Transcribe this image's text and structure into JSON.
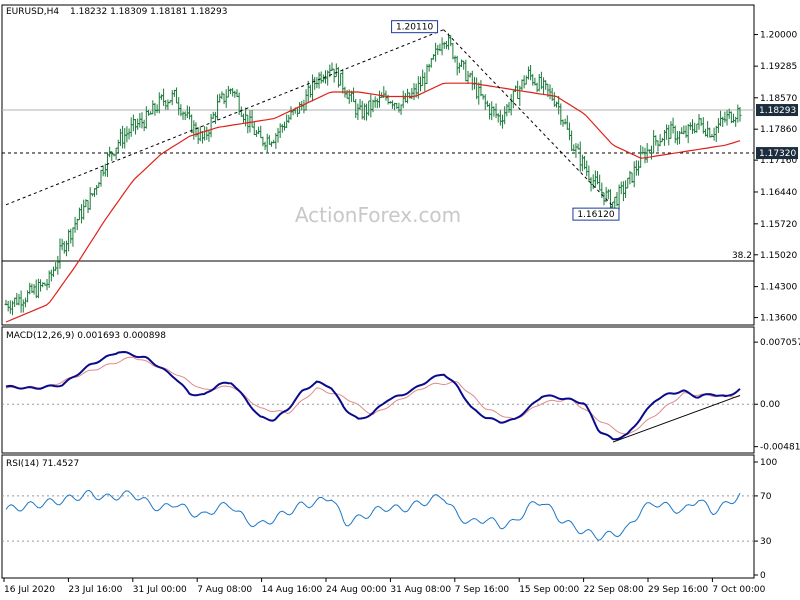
{
  "header": {
    "symbol": "EURUSD,H4",
    "ohlc": "1.18232 1.18309 1.18181 1.18293"
  },
  "watermark": "ActionForex.com",
  "colors": {
    "bars": "#1a7a3a",
    "ma": "#e0201a",
    "macd": "#0a0a8c",
    "signal": "#e08a8a",
    "rsi": "#1e78c8",
    "trendline": "#000000",
    "level": "#000000"
  },
  "chart_data": [
    {
      "type": "ohlc",
      "title": "EURUSD,H4 1.18232 1.18309 1.18181 1.18293",
      "x_ticks": [
        "16 Jul 2020",
        "23 Jul 16:00",
        "31 Jul 00:00",
        "7 Aug 08:00",
        "14 Aug 16:00",
        "24 Aug 00:00",
        "31 Aug 08:00",
        "7 Sep 16:00",
        "15 Sep 00:00",
        "22 Sep 08:00",
        "29 Sep 16:00",
        "7 Oct 00:00"
      ],
      "y_ticks": [
        "1.20000",
        "1.19285",
        "1.18570",
        "1.17860",
        "1.17160",
        "1.16440",
        "1.15720",
        "1.15020",
        "1.14300",
        "1.13600"
      ],
      "ylim": [
        1.135,
        1.206
      ],
      "current_price": "1.18293",
      "horizontal_level": "1.17320",
      "fib_level_label": "38.2",
      "fib_level_value": 1.1488,
      "annotations": [
        {
          "label": "1.20110",
          "value": 1.2011
        },
        {
          "label": "1.16120",
          "value": 1.1612
        }
      ],
      "series_close_anchors": [
        [
          0,
          1.139
        ],
        [
          3,
          1.141
        ],
        [
          6,
          1.144
        ],
        [
          8,
          1.152
        ],
        [
          10,
          1.158
        ],
        [
          12,
          1.163
        ],
        [
          14,
          1.171
        ],
        [
          16,
          1.176
        ],
        [
          18,
          1.179
        ],
        [
          20,
          1.181
        ],
        [
          22,
          1.185
        ],
        [
          24,
          1.186
        ],
        [
          26,
          1.18
        ],
        [
          28,
          1.176
        ],
        [
          30,
          1.184
        ],
        [
          32,
          1.188
        ],
        [
          34,
          1.181
        ],
        [
          36,
          1.176
        ],
        [
          38,
          1.177
        ],
        [
          40,
          1.181
        ],
        [
          42,
          1.184
        ],
        [
          44,
          1.19
        ],
        [
          46,
          1.193
        ],
        [
          48,
          1.188
        ],
        [
          50,
          1.182
        ],
        [
          52,
          1.184
        ],
        [
          54,
          1.186
        ],
        [
          56,
          1.184
        ],
        [
          58,
          1.187
        ],
        [
          60,
          1.192
        ],
        [
          62,
          1.2
        ],
        [
          64,
          1.194
        ],
        [
          66,
          1.189
        ],
        [
          68,
          1.184
        ],
        [
          70,
          1.181
        ],
        [
          72,
          1.186
        ],
        [
          74,
          1.191
        ],
        [
          76,
          1.188
        ],
        [
          78,
          1.185
        ],
        [
          80,
          1.176
        ],
        [
          82,
          1.17
        ],
        [
          84,
          1.165
        ],
        [
          86,
          1.162
        ],
        [
          88,
          1.166
        ],
        [
          90,
          1.172
        ],
        [
          92,
          1.176
        ],
        [
          94,
          1.178
        ],
        [
          96,
          1.177
        ],
        [
          98,
          1.18
        ],
        [
          100,
          1.178
        ],
        [
          102,
          1.181
        ],
        [
          104,
          1.183
        ]
      ],
      "ma_anchors": [
        [
          0,
          1.135
        ],
        [
          6,
          1.139
        ],
        [
          10,
          1.148
        ],
        [
          14,
          1.158
        ],
        [
          18,
          1.167
        ],
        [
          22,
          1.173
        ],
        [
          26,
          1.177
        ],
        [
          30,
          1.179
        ],
        [
          34,
          1.18
        ],
        [
          38,
          1.181
        ],
        [
          42,
          1.184
        ],
        [
          46,
          1.187
        ],
        [
          50,
          1.187
        ],
        [
          54,
          1.186
        ],
        [
          58,
          1.186
        ],
        [
          62,
          1.189
        ],
        [
          66,
          1.189
        ],
        [
          70,
          1.188
        ],
        [
          74,
          1.187
        ],
        [
          78,
          1.186
        ],
        [
          82,
          1.182
        ],
        [
          86,
          1.175
        ],
        [
          90,
          1.172
        ],
        [
          94,
          1.173
        ],
        [
          98,
          1.174
        ],
        [
          102,
          1.175
        ],
        [
          104,
          1.176
        ]
      ]
    },
    {
      "type": "line",
      "title": "MACD(12,26,9) 0.001693 0.000898",
      "y_ticks": [
        "0.007057",
        "0.00",
        "-0.004818"
      ],
      "ylim": [
        -0.0052,
        0.0073
      ],
      "series": [
        {
          "name": "MACD",
          "anchors": [
            [
              0,
              0.002
            ],
            [
              4,
              0.0018
            ],
            [
              8,
              0.0022
            ],
            [
              12,
              0.0045
            ],
            [
              16,
              0.006
            ],
            [
              20,
              0.0052
            ],
            [
              24,
              0.003
            ],
            [
              26,
              0.0012
            ],
            [
              28,
              0.001
            ],
            [
              30,
              0.0022
            ],
            [
              32,
              0.0025
            ],
            [
              34,
              0.0005
            ],
            [
              36,
              -0.0015
            ],
            [
              38,
              -0.0018
            ],
            [
              40,
              -0.0005
            ],
            [
              42,
              0.0015
            ],
            [
              44,
              0.0025
            ],
            [
              46,
              0.002
            ],
            [
              48,
              -0.0005
            ],
            [
              50,
              -0.0018
            ],
            [
              52,
              -0.001
            ],
            [
              54,
              0.0005
            ],
            [
              56,
              0.001
            ],
            [
              58,
              0.0018
            ],
            [
              60,
              0.0028
            ],
            [
              62,
              0.0035
            ],
            [
              64,
              0.002
            ],
            [
              66,
              -0.0005
            ],
            [
              68,
              -0.0015
            ],
            [
              70,
              -0.002
            ],
            [
              72,
              -0.0018
            ],
            [
              74,
              -0.0005
            ],
            [
              76,
              0.001
            ],
            [
              78,
              0.0008
            ],
            [
              80,
              0.0005
            ],
            [
              82,
              0.0001
            ],
            [
              84,
              -0.003
            ],
            [
              86,
              -0.004
            ],
            [
              88,
              -0.0035
            ],
            [
              90,
              -0.0015
            ],
            [
              92,
              0.0005
            ],
            [
              94,
              0.0012
            ],
            [
              96,
              0.0015
            ],
            [
              98,
              0.0008
            ],
            [
              100,
              0.0012
            ],
            [
              102,
              0.0008
            ],
            [
              104,
              0.0017
            ]
          ]
        },
        {
          "name": "Signal",
          "anchors": [
            [
              0,
              0.0018
            ],
            [
              6,
              0.002
            ],
            [
              12,
              0.0038
            ],
            [
              18,
              0.0054
            ],
            [
              24,
              0.0035
            ],
            [
              28,
              0.0016
            ],
            [
              32,
              0.0021
            ],
            [
              36,
              -0.0005
            ],
            [
              40,
              -0.001
            ],
            [
              44,
              0.0018
            ],
            [
              48,
              0.0008
            ],
            [
              52,
              -0.0012
            ],
            [
              56,
              0.0006
            ],
            [
              60,
              0.0022
            ],
            [
              64,
              0.0025
            ],
            [
              68,
              -0.0005
            ],
            [
              72,
              -0.0018
            ],
            [
              76,
              0.0002
            ],
            [
              80,
              0.0006
            ],
            [
              84,
              -0.0018
            ],
            [
              88,
              -0.0036
            ],
            [
              92,
              -0.0012
            ],
            [
              96,
              0.0012
            ],
            [
              100,
              0.001
            ],
            [
              104,
              0.0009
            ]
          ]
        }
      ]
    },
    {
      "type": "line",
      "title": "RSI(14) 71.4527",
      "y_ticks": [
        "100",
        "70",
        "30",
        "0"
      ],
      "ylim": [
        0,
        100
      ],
      "series": [
        {
          "name": "RSI",
          "anchors": [
            [
              0,
              58
            ],
            [
              4,
              62
            ],
            [
              8,
              66
            ],
            [
              12,
              72
            ],
            [
              14,
              68
            ],
            [
              18,
              72
            ],
            [
              20,
              64
            ],
            [
              22,
              58
            ],
            [
              24,
              64
            ],
            [
              26,
              56
            ],
            [
              28,
              52
            ],
            [
              30,
              60
            ],
            [
              32,
              62
            ],
            [
              34,
              48
            ],
            [
              36,
              44
            ],
            [
              38,
              50
            ],
            [
              40,
              56
            ],
            [
              42,
              62
            ],
            [
              44,
              64
            ],
            [
              46,
              70
            ],
            [
              48,
              46
            ],
            [
              50,
              50
            ],
            [
              52,
              56
            ],
            [
              54,
              60
            ],
            [
              56,
              58
            ],
            [
              58,
              62
            ],
            [
              60,
              66
            ],
            [
              62,
              70
            ],
            [
              64,
              52
            ],
            [
              66,
              46
            ],
            [
              68,
              50
            ],
            [
              70,
              44
            ],
            [
              72,
              46
            ],
            [
              74,
              60
            ],
            [
              76,
              66
            ],
            [
              78,
              52
            ],
            [
              80,
              44
            ],
            [
              82,
              38
            ],
            [
              84,
              34
            ],
            [
              86,
              36
            ],
            [
              88,
              40
            ],
            [
              90,
              58
            ],
            [
              92,
              64
            ],
            [
              94,
              60
            ],
            [
              96,
              56
            ],
            [
              98,
              68
            ],
            [
              100,
              56
            ],
            [
              102,
              62
            ],
            [
              104,
              71
            ]
          ]
        }
      ]
    }
  ],
  "panel_labels": {
    "macd_zero": "0.00",
    "rsi_labels": [
      "100",
      "70",
      "30",
      "0"
    ]
  }
}
